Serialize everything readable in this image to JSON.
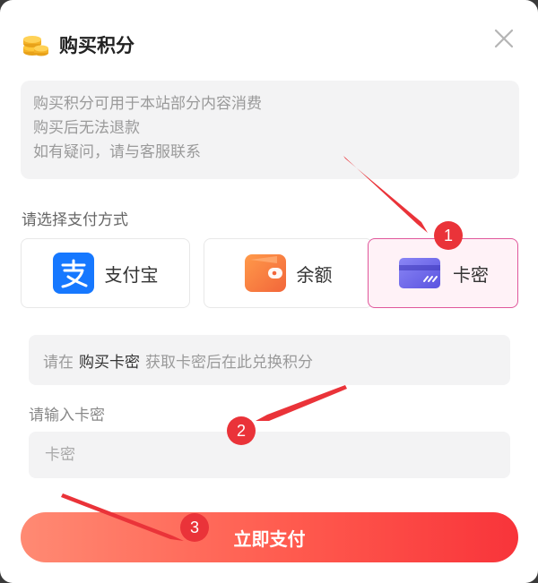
{
  "dialog": {
    "title": "购买积分",
    "icons": {
      "title": "coins-icon",
      "close": "close-icon"
    }
  },
  "info": {
    "lines": [
      "购买积分可用于本站部分内容消费",
      "购买后无法退款",
      "如有疑问，请与客服联系"
    ]
  },
  "payment": {
    "section_label": "请选择支付方式",
    "options": [
      {
        "label": "支付宝",
        "icon": "alipay-icon",
        "selected": false
      },
      {
        "label": "余额",
        "icon": "wallet-icon",
        "selected": false
      },
      {
        "label": "卡密",
        "icon": "card-icon",
        "selected": true
      }
    ]
  },
  "card_section": {
    "notice_prefix": "请在",
    "notice_link": "购买卡密",
    "notice_suffix": "获取卡密后在此兑换积分",
    "input_label": "请输入卡密",
    "input_placeholder": "卡密",
    "input_value": ""
  },
  "submit_label": "立即支付",
  "annotations": {
    "badges": [
      "1",
      "2",
      "3"
    ],
    "color": "#ea3339"
  },
  "colors": {
    "selected_border": "#e0579b",
    "button_gradient_start": "#ff8a73",
    "button_gradient_end": "#f8343a"
  }
}
